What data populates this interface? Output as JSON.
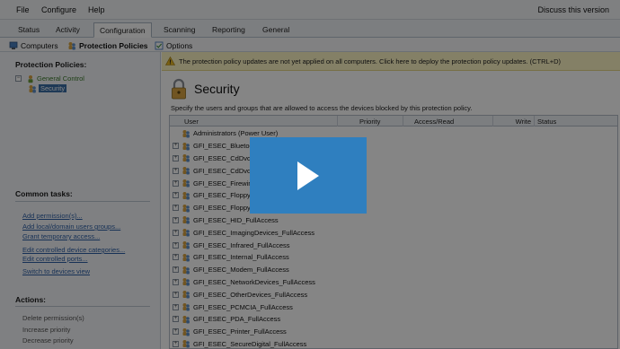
{
  "menu": {
    "file": "File",
    "configure": "Configure",
    "help": "Help",
    "discuss": "Discuss this version"
  },
  "tabs": [
    "Status",
    "Activity",
    "Configuration",
    "Scanning",
    "Reporting",
    "General"
  ],
  "toolbar": {
    "computers": "Computers",
    "protection_policies": "Protection Policies",
    "options": "Options"
  },
  "left": {
    "title": "Protection Policies:",
    "tree_root": "General Control",
    "tree_child": "Security",
    "common_tasks_title": "Common tasks:",
    "common_tasks": [
      "Add permission(s)...",
      "Add local/domain users groups...",
      "Grant temporary access...",
      "Edit controlled device categories...",
      "Edit controlled ports...",
      "Switch to devices view"
    ],
    "actions_title": "Actions:",
    "actions": [
      "Delete permission(s)",
      "Increase priority",
      "Decrease priority"
    ]
  },
  "main": {
    "banner": "The protection policy updates are not yet applied on all computers. Click here to deploy the protection policy updates. (CTRL+D)",
    "section_title": "Security",
    "description": "Specify the users and groups that are allowed to access the devices blocked by this protection policy.",
    "columns": [
      "User",
      "Priority",
      "Access/Read",
      "Write",
      "Status"
    ],
    "rows": [
      {
        "user": "Administrators (Power User)",
        "expander": ""
      },
      {
        "user": "GFI_ESEC_Bluetooth_FullAccess",
        "expander": "+"
      },
      {
        "user": "GFI_ESEC_CdDvd_FullAccess",
        "expander": "+"
      },
      {
        "user": "GFI_ESEC_CdDvd_ReadOnly",
        "expander": "+"
      },
      {
        "user": "GFI_ESEC_Firewire_FullAccess",
        "expander": "+"
      },
      {
        "user": "GFI_ESEC_Floppy_FullAccess",
        "expander": "+"
      },
      {
        "user": "GFI_ESEC_Floppy_ReadOnly",
        "expander": "+"
      },
      {
        "user": "GFI_ESEC_HID_FullAccess",
        "expander": "+"
      },
      {
        "user": "GFI_ESEC_ImagingDevices_FullAccess",
        "expander": "+"
      },
      {
        "user": "GFI_ESEC_Infrared_FullAccess",
        "expander": "+"
      },
      {
        "user": "GFI_ESEC_Internal_FullAccess",
        "expander": "+"
      },
      {
        "user": "GFI_ESEC_Modem_FullAccess",
        "expander": "+"
      },
      {
        "user": "GFI_ESEC_NetworkDevices_FullAccess",
        "expander": "+"
      },
      {
        "user": "GFI_ESEC_OtherDevices_FullAccess",
        "expander": "+"
      },
      {
        "user": "GFI_ESEC_PCMCIA_FullAccess",
        "expander": "+"
      },
      {
        "user": "GFI_ESEC_PDA_FullAccess",
        "expander": "+"
      },
      {
        "user": "GFI_ESEC_Printer_FullAccess",
        "expander": "+"
      },
      {
        "user": "GFI_ESEC_SecureDigital_FullAccess",
        "expander": "+"
      }
    ]
  },
  "colors": {
    "accent": "#2f7fbf",
    "banner": "#fdf5c4",
    "link": "#2d5fa6",
    "overlay": "rgba(0,0,0,0.48)"
  },
  "icons": {
    "play": "play-icon",
    "warning": "warning-icon",
    "lock": "lock-icon",
    "group": "group-icon"
  }
}
